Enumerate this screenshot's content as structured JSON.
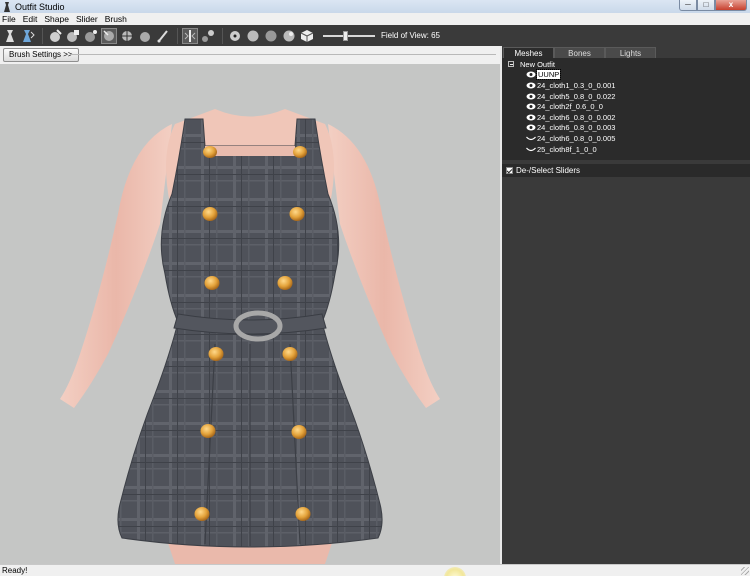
{
  "window": {
    "title": "Outfit Studio",
    "minimize_glyph": "─",
    "maximize_glyph": "□",
    "close_glyph": "x"
  },
  "menu": [
    "File",
    "Edit",
    "Shape",
    "Slider",
    "Brush"
  ],
  "toolbar": {
    "fov_label": "Field of View: 65",
    "fov_value": 65
  },
  "brush_settings_label": "Brush Settings >>",
  "tabs": [
    "Meshes",
    "Bones",
    "Lights"
  ],
  "active_tab": "Meshes",
  "outfit": {
    "name": "New Outfit",
    "meshes": [
      {
        "name": "UUNP",
        "icon": "eye-icon",
        "selected": true
      },
      {
        "name": "24_cloth1_0.3_0_0.001",
        "icon": "eye-icon"
      },
      {
        "name": "24_cloth5_0.8_0_0.022",
        "icon": "eye-icon"
      },
      {
        "name": "24_cloth2f_0.6_0_0",
        "icon": "eye-icon"
      },
      {
        "name": "24_cloth6_0.8_0_0.002",
        "icon": "eye-icon"
      },
      {
        "name": "24_cloth6_0.8_0_0.003",
        "icon": "eye-icon"
      },
      {
        "name": "24_cloth6_0.8_0_0.005",
        "icon": "closed-eye-icon"
      },
      {
        "name": "25_cloth8f_1_0_0",
        "icon": "closed-eye-icon"
      }
    ]
  },
  "sliders_header": "De-/Select Sliders",
  "status": "Ready!",
  "colors": {
    "viewport_bg": "#c5c6c5",
    "dark_panel": "#3a3a3a",
    "dress": "#4e5159",
    "buttons": "#e3a23a",
    "skin": "#e9bfb2"
  }
}
